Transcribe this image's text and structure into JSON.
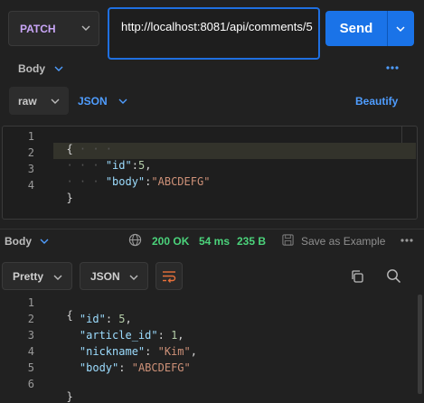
{
  "request": {
    "method": "PATCH",
    "url": "http://localhost:8081/api/comments/5",
    "send_label": "Send"
  },
  "request_tabs": {
    "body_label": "Body",
    "more_icon": "ellipsis-icon"
  },
  "body_options": {
    "mode": "raw",
    "language": "JSON",
    "beautify_label": "Beautify"
  },
  "request_body": {
    "line_numbers": [
      "1",
      "2",
      "3",
      "4"
    ],
    "lines": [
      {
        "open": "{"
      },
      {
        "key": "\"id\"",
        "sep": ":",
        "value": "5",
        "trail": ","
      },
      {
        "key": "\"body\"",
        "sep": ":",
        "value": "\"ABCDEFG\""
      },
      {
        "close": "}"
      }
    ]
  },
  "response_bar": {
    "body_label": "Body",
    "status": "200 OK",
    "time": "54 ms",
    "size": "235 B",
    "save_label": "Save as Example"
  },
  "response_controls": {
    "format": "Pretty",
    "language": "JSON"
  },
  "response_body": {
    "line_numbers": [
      "1",
      "2",
      "3",
      "4",
      "5",
      "6"
    ],
    "lines": [
      {
        "open": "{"
      },
      {
        "key": "\"id\"",
        "value": "5"
      },
      {
        "key": "\"article_id\"",
        "value": "1"
      },
      {
        "key": "\"nickname\"",
        "value": "\"Kim\""
      },
      {
        "key": "\"body\"",
        "value": "\"ABCDEFG\""
      },
      {
        "close": "}"
      }
    ]
  },
  "colors": {
    "accent": "#1a73e8",
    "status_ok": "#4bd37b",
    "method": "#c9a6f7"
  }
}
